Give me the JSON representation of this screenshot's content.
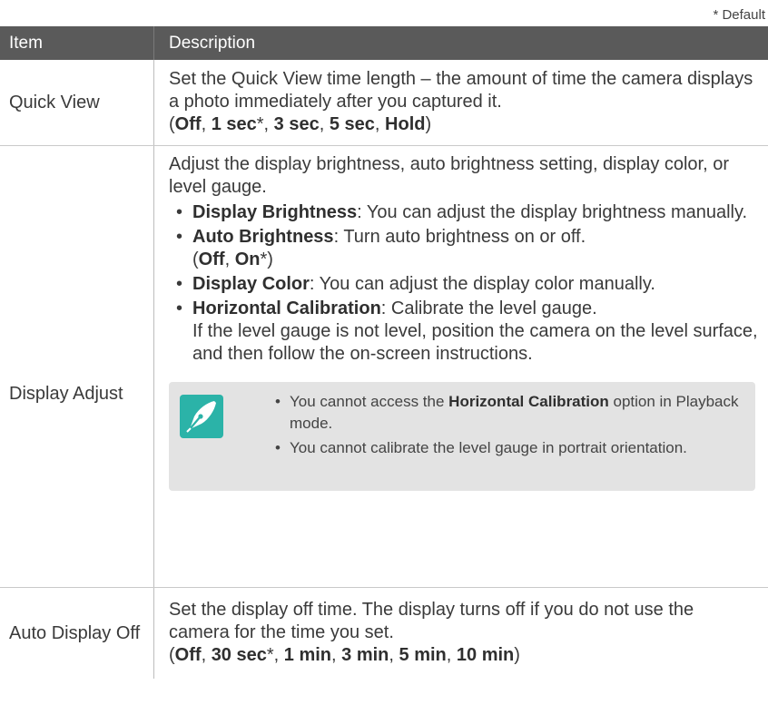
{
  "default_note": "* Default",
  "header": {
    "item": "Item",
    "description": "Description"
  },
  "rows": [
    {
      "item": "Quick View",
      "text": "Set the Quick View time length – the amount of time the camera displays a photo immediately after you captured it.",
      "options": {
        "open": "(",
        "o1": "Off",
        "o2": "1 sec",
        "o3": "3 sec",
        "o4": "5 sec",
        "o5": "Hold",
        "star": "*",
        "sep": ", ",
        "close": ")"
      }
    },
    {
      "item": "Display Adjust",
      "intro": "Adjust the display brightness, auto brightness setting, display color, or level gauge.",
      "bullets": [
        {
          "term": "Display Brightness",
          "text": ": You can adjust the display brightness manually."
        },
        {
          "term": "Auto Brightness",
          "text": ": Turn auto brightness on or off.",
          "opt_open": "(",
          "opt1": "Off",
          "sep": ", ",
          "opt2": "On",
          "star": "*",
          "opt_close": ")"
        },
        {
          "term": "Display Color",
          "text": ": You can adjust the display color manually."
        },
        {
          "term": "Horizontal Calibration",
          "text": ": Calibrate the level gauge.",
          "extra": "If the level gauge is not level, position the camera on the level surface, and then follow the on-screen instructions."
        }
      ],
      "note": {
        "icon": "pen-nib-icon",
        "items": [
          {
            "before": "You cannot access the ",
            "term": "Horizontal Calibration",
            "after": " option in Playback mode."
          },
          {
            "text": "You cannot calibrate the level gauge in portrait orientation."
          }
        ]
      }
    },
    {
      "item": "Auto Display Off",
      "text": "Set the display off time. The display turns off if you do not use the camera for the time you set.",
      "options": {
        "open": "(",
        "o1": "Off",
        "o2": "30 sec",
        "o3": "1 min",
        "o4": "3 min",
        "o5": "5 min",
        "o6": "10 min",
        "star": "*",
        "sep": ", ",
        "close": ")"
      }
    }
  ],
  "colors": {
    "header_bg": "#5a5a5a",
    "note_bg": "#e3e3e3",
    "icon_bg": "#2bb3a8"
  }
}
